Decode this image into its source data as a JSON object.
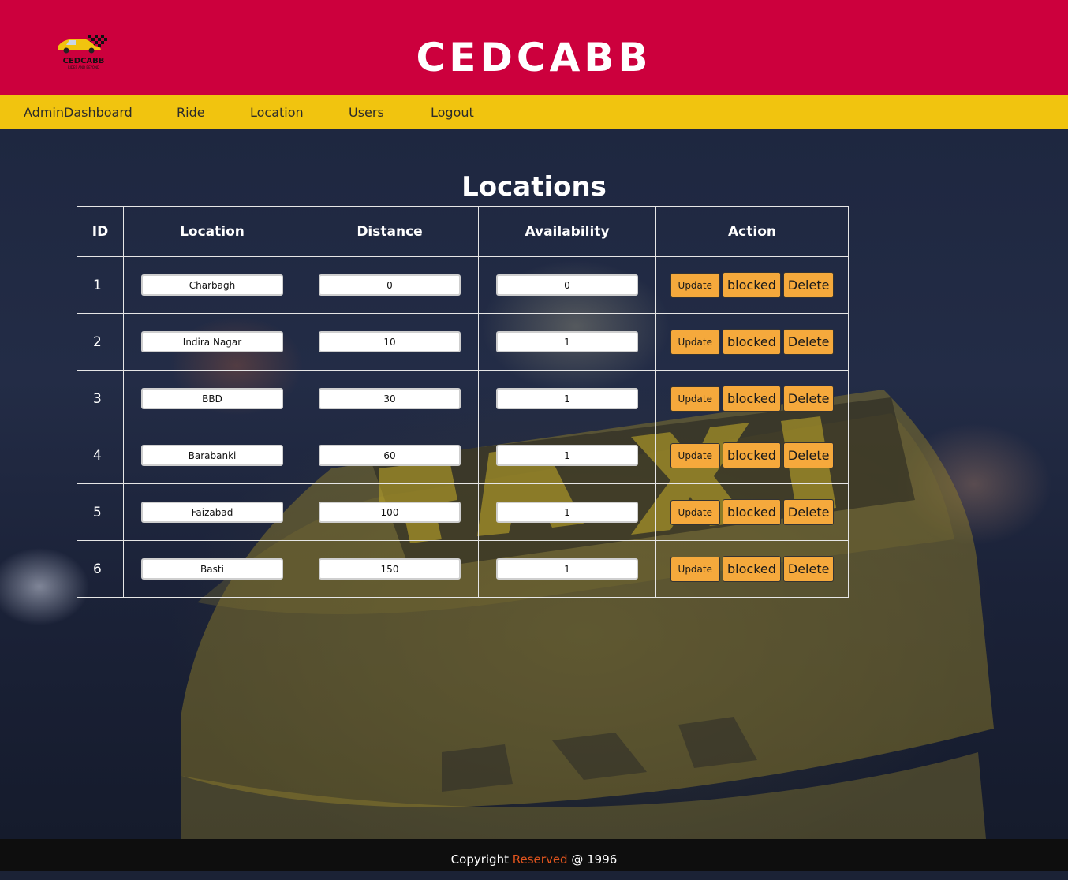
{
  "header": {
    "site_title": "CEDCABB",
    "logo_text": "CEDCABB",
    "logo_tagline": "RIDES AND BEYOND",
    "brand_color": "#cc003d",
    "nav_color": "#f1c40f"
  },
  "nav": {
    "items": [
      "AdminDashboard",
      "Ride",
      "Location",
      "Users",
      "Logout"
    ]
  },
  "main": {
    "heading": "Locations",
    "columns": [
      "ID",
      "Location",
      "Distance",
      "Availability",
      "Action"
    ],
    "rows": [
      {
        "id": "1",
        "location": "Charbagh",
        "distance": "0",
        "availability": "0"
      },
      {
        "id": "2",
        "location": "Indira Nagar",
        "distance": "10",
        "availability": "1"
      },
      {
        "id": "3",
        "location": "BBD",
        "distance": "30",
        "availability": "1"
      },
      {
        "id": "4",
        "location": "Barabanki",
        "distance": "60",
        "availability": "1"
      },
      {
        "id": "5",
        "location": "Faizabad",
        "distance": "100",
        "availability": "1"
      },
      {
        "id": "6",
        "location": "Basti",
        "distance": "150",
        "availability": "1"
      }
    ],
    "actions": {
      "update": "Update",
      "blocked": "blocked",
      "delete": "Delete"
    },
    "button_color": "#f5a93c"
  },
  "footer": {
    "prefix": "Copyright",
    "accent": "Reserved",
    "suffix": "@ 1996",
    "accent_color": "#e2551e"
  }
}
